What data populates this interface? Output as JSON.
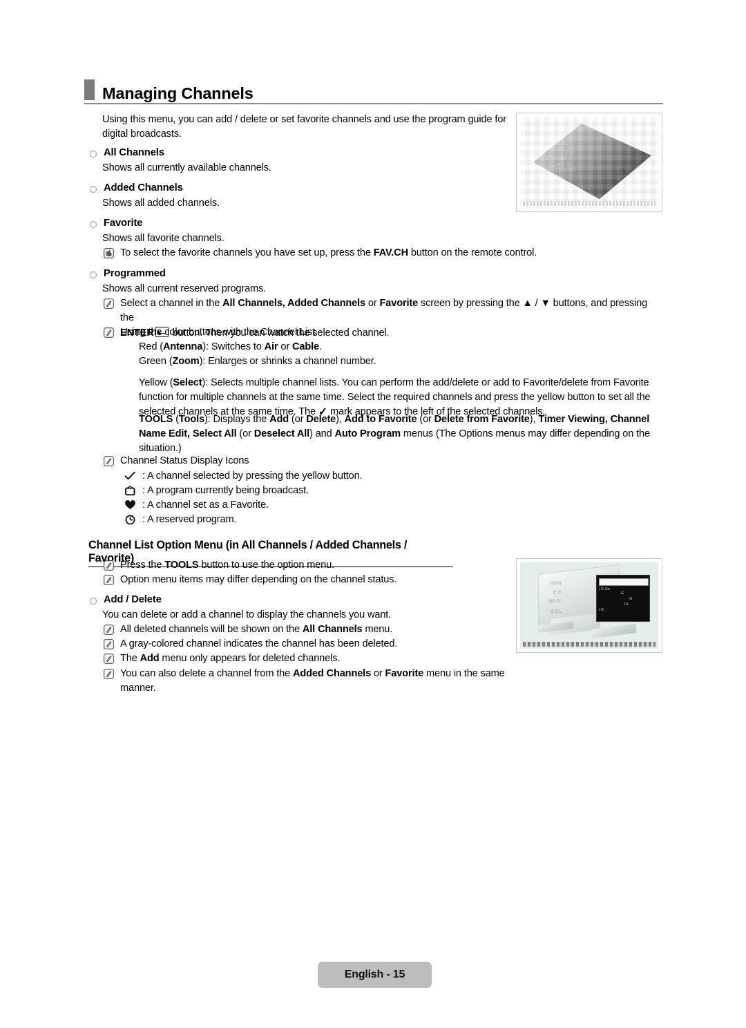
{
  "document": {
    "heading": "Managing Channels",
    "footer_label": "English - 15",
    "accent_color": "#7b7b7b",
    "rule_color": "#8a8a8a"
  },
  "intro": {
    "line1": "Using this menu, you can add / delete or set favorite channels and use the program guide for",
    "line2": "digital broadcasts."
  },
  "sections": [
    {
      "label": "All Channels",
      "desc": "Shows all currently available channels."
    },
    {
      "label": "Added Channels",
      "desc": "Shows all added channels."
    },
    {
      "label": "Favorite",
      "desc": "Shows all favorite channels."
    },
    {
      "label": "Programmed",
      "desc": "Shows all current reserved programs."
    }
  ],
  "favorite_note": {
    "icon": "pointing-hand-icon",
    "text_a": "To select the favorite channels you have set up, press the ",
    "bold_b": "FAV.CH",
    "text_c": " button on the remote control."
  },
  "programmed_notes": {
    "select_channel": {
      "icon": "note-icon",
      "a": "Select a channel in the ",
      "b1": "All Channels, Added Channels",
      "c": " or ",
      "b2": "Favorite",
      "d": " screen by pressing the ",
      "up_glyph": "▲",
      "sep": " / ",
      "down_glyph": "▼",
      "e": " buttons, and pressing the",
      "line2_bold": "ENTER",
      "line2_rest": " button. Then you can watch the selected channel."
    },
    "color_buttons": {
      "icon": "note-icon",
      "title": "Using the color buttons with the Channel List",
      "red": {
        "a": "Red (",
        "b": "Antenna",
        "c": "): Switches to ",
        "d": "Air",
        "e": " or ",
        "f": "Cable",
        "g": "."
      },
      "green": {
        "a": "Green (",
        "b": "Zoom",
        "c": "): Enlarges or shrinks a channel number."
      },
      "yellow": {
        "a": "Yellow (",
        "b": "Select",
        "c": "): Selects multiple channel lists. You can perform the add/delete or add to Favorite/delete from Favorite",
        "line2": "function for multiple channels at the same time. Select the required channels and press the yellow button to set all the",
        "line3_a": "selected channels at the same time. The ",
        "line3_check": "✓",
        "line3_b": " mark appears to the left of the selected channels."
      },
      "tools": {
        "b1": "TOOLS",
        "t1": " (",
        "b2": "Tools",
        "t2": "): Displays the ",
        "b3": "Add",
        "t3": " (or ",
        "b4": "Delete",
        "t4": "), ",
        "b5": "Add to Favorite",
        "t5": " (or ",
        "b6": "Delete from Favorite",
        "t6": "), ",
        "b7": "Timer Viewing, Channel",
        "line2_b1": "Name Edit, Select All",
        "line2_t1": " (or ",
        "line2_b2": "Deselect All",
        "line2_t2": ") and ",
        "line2_b3": "Auto Program",
        "line2_t3": " menus (The Options menus may differ depending on the",
        "line3": "situation.)"
      }
    },
    "status_icons": {
      "icon": "note-icon",
      "title": "Channel Status Display Icons",
      "items": [
        {
          "glyph": "✓",
          "name": "check-icon",
          "text": ": A channel selected by pressing the yellow button."
        },
        {
          "glyph": "὏a",
          "name": "tv-icon",
          "text": ": A program currently being broadcast."
        },
        {
          "glyph": "♥",
          "name": "heart-icon",
          "text": ": A channel set as a Favorite."
        },
        {
          "glyph": "ὕ2",
          "name": "clock-icon",
          "text": ": A reserved program."
        }
      ]
    }
  },
  "option_menu": {
    "heading": "Channel List Option Menu (in All Channels / Added Channels / Favorite)",
    "notes": [
      {
        "a": "Press the ",
        "b": "TOOLS",
        "c": " button to use the option menu."
      },
      {
        "a": "Option menu items may differ depending on the channel status.",
        "b": "",
        "c": ""
      }
    ],
    "add_delete": {
      "label": "Add / Delete",
      "desc": "You can delete or add a channel to display the channels you want.",
      "notes": [
        {
          "a": "All deleted channels will be shown on the ",
          "b": "All Channels",
          "c": " menu."
        },
        {
          "a": "A gray-colored channel indicates the channel has been deleted.",
          "b": "",
          "c": ""
        },
        {
          "a": "The ",
          "b": "Add",
          "c": " menu only appears for deleted channels."
        },
        {
          "a": "You can also delete a channel from the ",
          "b": "Added Channels",
          "c": " or ",
          "b2": "Favorite",
          "d": " menu in the same",
          "line2": "manner."
        }
      ]
    }
  },
  "screenshots": {
    "top": {
      "name": "channel-list-screenshot",
      "alt": "Pixelated TV channel list menu screenshot"
    },
    "bottom": {
      "name": "option-menu-screenshot",
      "alt": "TV with option menu popup screenshot"
    }
  }
}
